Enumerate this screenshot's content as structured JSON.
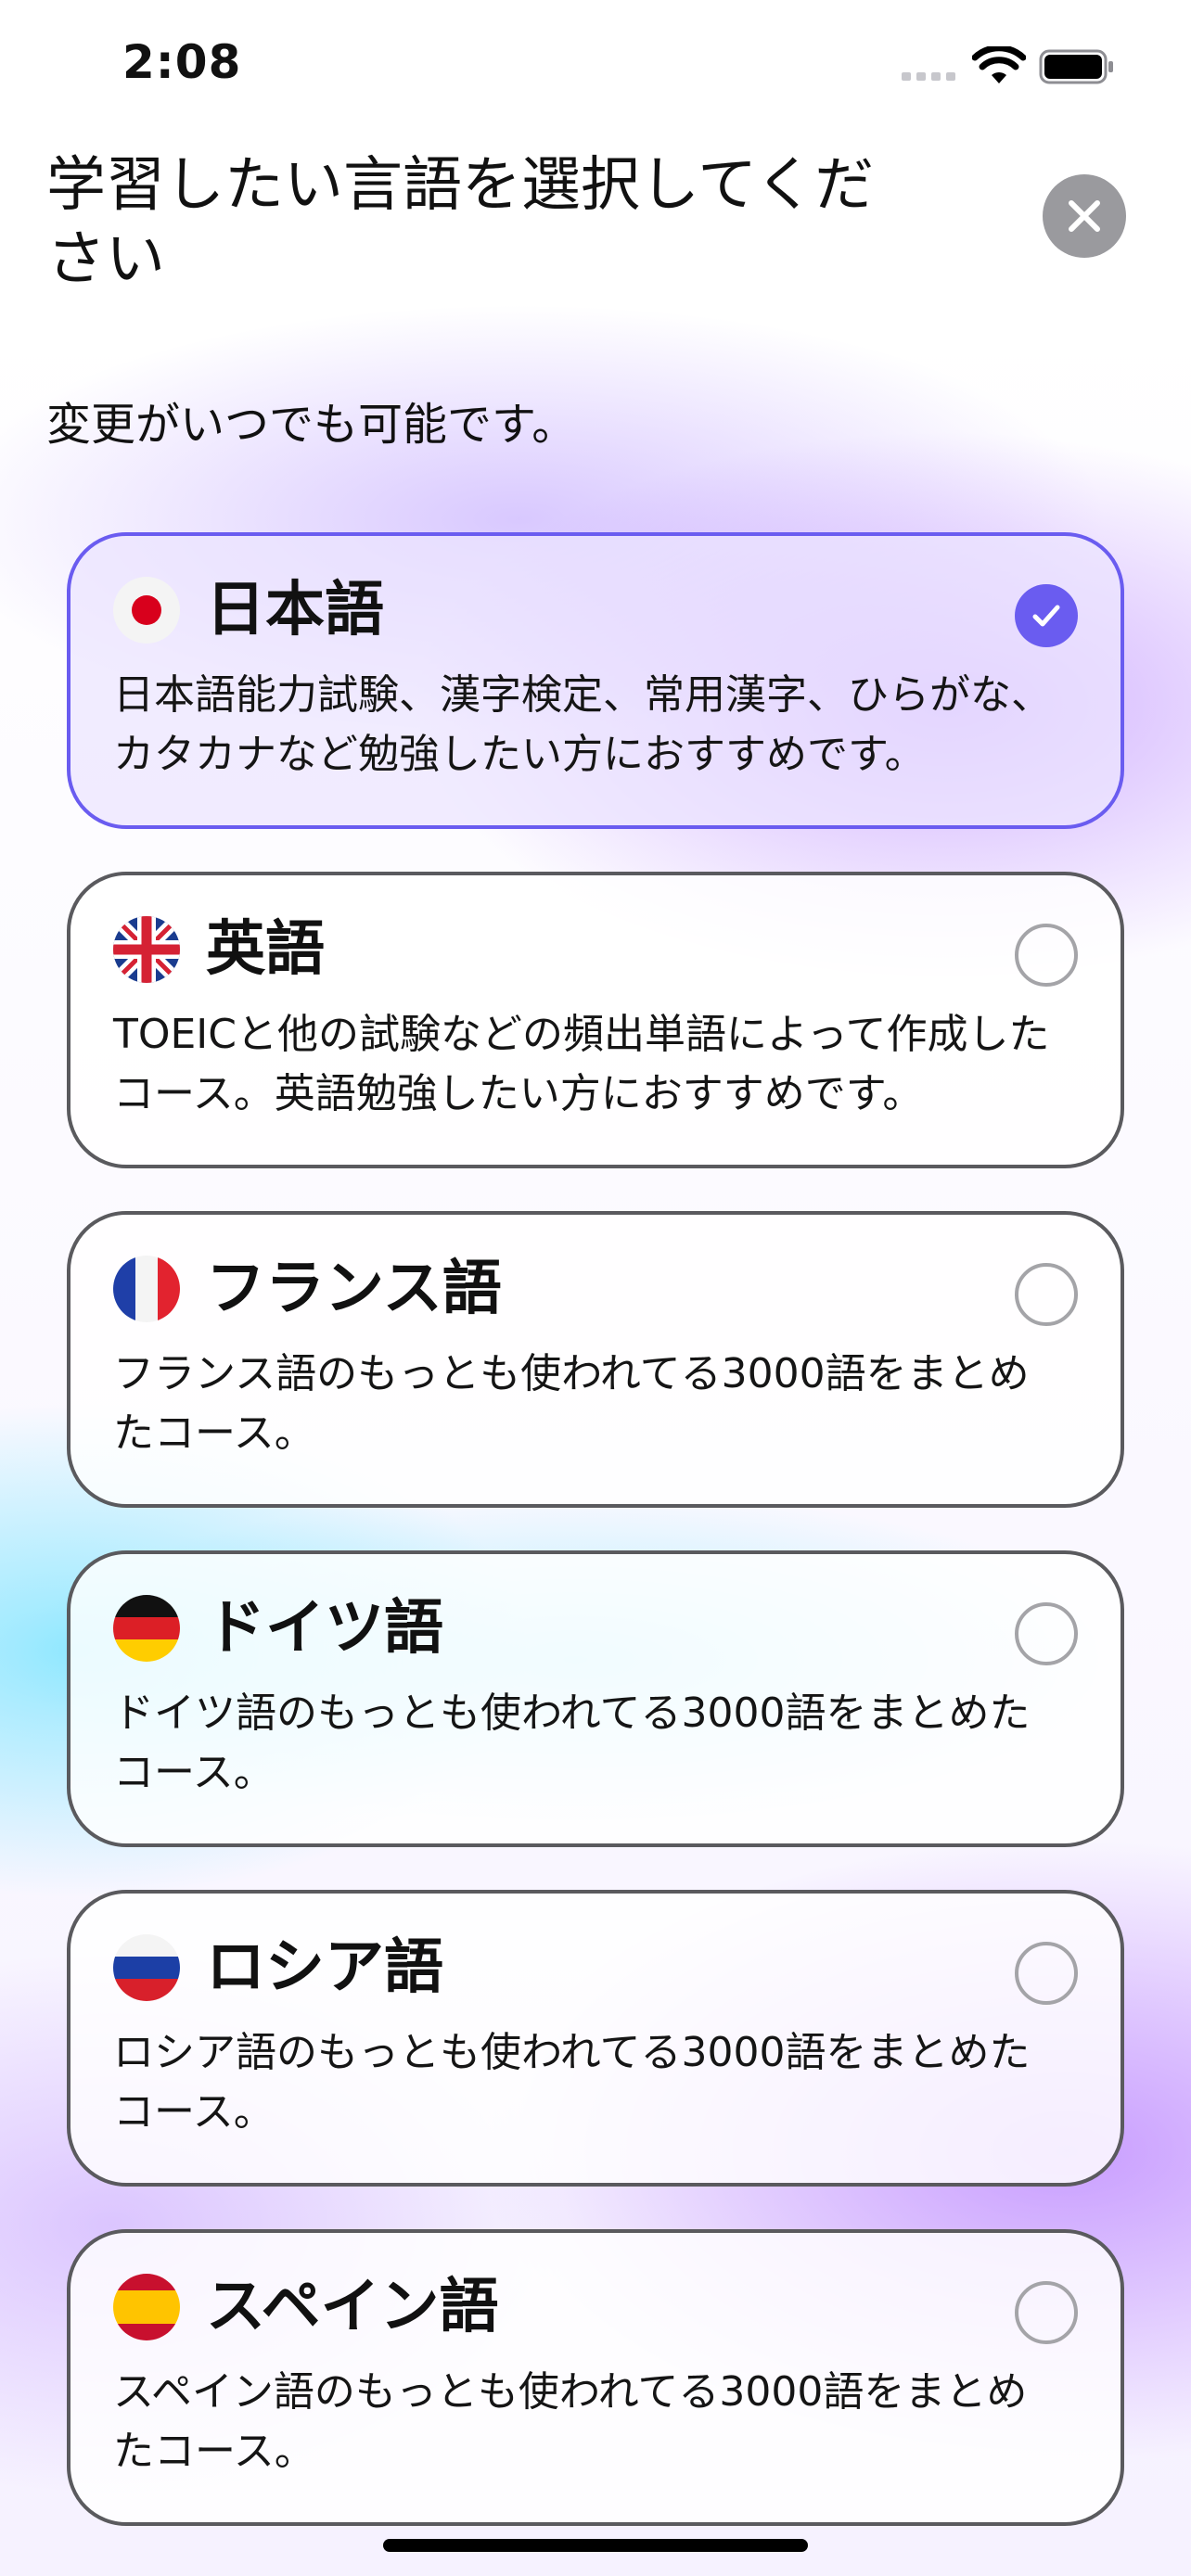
{
  "status_bar": {
    "time": "2:08"
  },
  "header": {
    "title": "学習したい言語を選択してください",
    "subtitle": "変更がいつでも可能です。"
  },
  "colors": {
    "accent": "#6a5cf0",
    "close_button": "#9a9a9e"
  },
  "languages": [
    {
      "name": "日本語",
      "flag_icon": "japan-flag-icon",
      "selected": true,
      "description": "日本語能力試験、漢字検定、常用漢字、ひらがな、カタカナなど勉強したい方におすすめです。"
    },
    {
      "name": "英語",
      "flag_icon": "uk-flag-icon",
      "selected": false,
      "description": "TOEICと他の試験などの頻出単語によって作成したコース。英語勉強したい方におすすめです。"
    },
    {
      "name": "フランス語",
      "flag_icon": "france-flag-icon",
      "selected": false,
      "description": "フランス語のもっとも使われてる3000語をまとめたコース。"
    },
    {
      "name": "ドイツ語",
      "flag_icon": "germany-flag-icon",
      "selected": false,
      "description": "ドイツ語のもっとも使われてる3000語をまとめたコース。"
    },
    {
      "name": "ロシア語",
      "flag_icon": "russia-flag-icon",
      "selected": false,
      "description": "ロシア語のもっとも使われてる3000語をまとめたコース。"
    },
    {
      "name": "スペイン語",
      "flag_icon": "spain-flag-icon",
      "selected": false,
      "description": "スペイン語のもっとも使われてる3000語をまとめたコース。"
    }
  ]
}
